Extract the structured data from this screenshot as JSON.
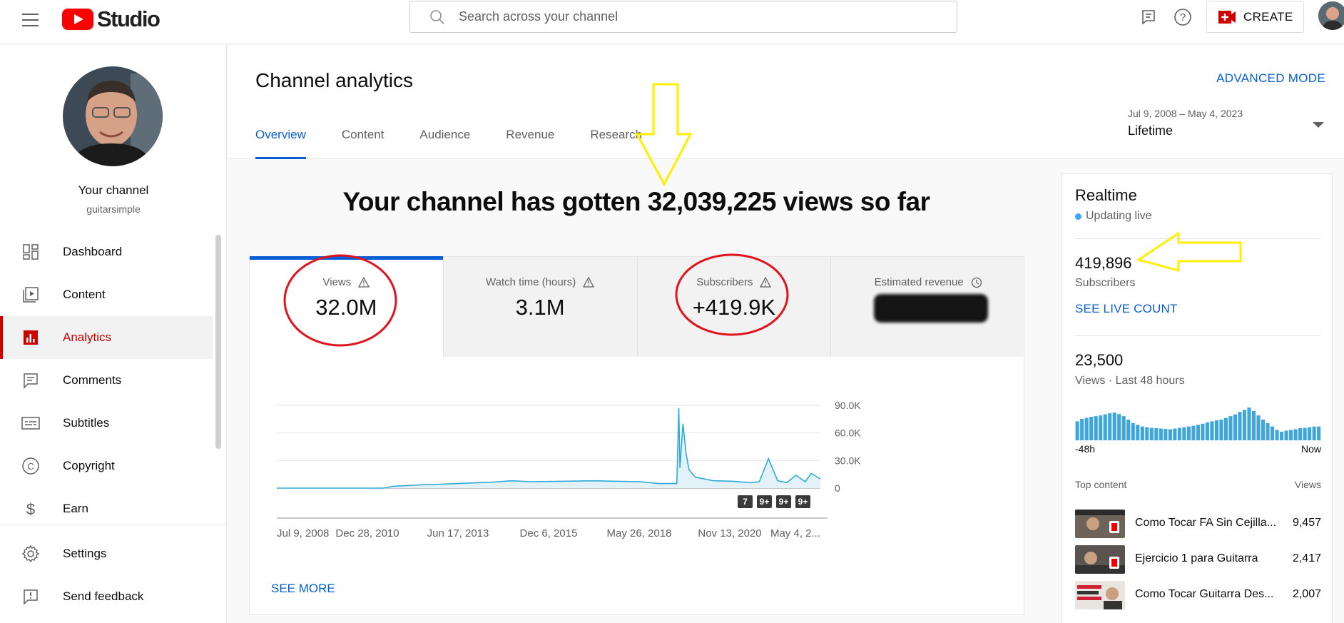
{
  "app": {
    "logo_text": "Studio",
    "search_placeholder": "Search across your channel",
    "create_label": "CREATE"
  },
  "sidebar": {
    "channel_name": "Your channel",
    "channel_handle": "guitarsimple",
    "items": [
      {
        "label": "Dashboard",
        "icon": "dashboard-icon"
      },
      {
        "label": "Content",
        "icon": "content-icon"
      },
      {
        "label": "Analytics",
        "icon": "analytics-icon",
        "active": true
      },
      {
        "label": "Comments",
        "icon": "comments-icon"
      },
      {
        "label": "Subtitles",
        "icon": "subtitles-icon"
      },
      {
        "label": "Copyright",
        "icon": "copyright-icon"
      },
      {
        "label": "Earn",
        "icon": "earn-icon"
      }
    ],
    "bottom_items": [
      {
        "label": "Settings",
        "icon": "gear-icon"
      },
      {
        "label": "Send feedback",
        "icon": "feedback-icon"
      }
    ]
  },
  "header": {
    "title": "Channel analytics",
    "advanced_mode": "ADVANCED MODE",
    "tabs": [
      "Overview",
      "Content",
      "Audience",
      "Revenue",
      "Research"
    ],
    "date_sub": "Jul 9, 2008 – May 4, 2023",
    "date_main": "Lifetime"
  },
  "headline": "Your channel has gotten 32,039,225 views so far",
  "metrics": [
    {
      "label": "Views",
      "value": "32.0M",
      "icon": "warning-icon"
    },
    {
      "label": "Watch time (hours)",
      "value": "3.1M",
      "icon": "warning-icon"
    },
    {
      "label": "Subscribers",
      "value": "+419.9K",
      "icon": "warning-icon"
    },
    {
      "label": "Estimated revenue",
      "value": "",
      "icon": "clock-icon"
    }
  ],
  "see_more": "SEE MORE",
  "chart_data": {
    "type": "area",
    "series": [
      {
        "name": "Views",
        "color": "#2eaad9"
      }
    ],
    "x_ticks": [
      "Jul 9, 2008",
      "Dec 28, 2010",
      "Jun 17, 2013",
      "Dec 6, 2015",
      "May 26, 2018",
      "Nov 13, 2020",
      "May 4, 2..."
    ],
    "y_ticks": [
      "90.0K",
      "60.0K",
      "30.0K",
      "0"
    ],
    "ylim": [
      0,
      90000
    ],
    "x": [
      "2008-07",
      "2011-06",
      "2011-09",
      "2012-06",
      "2013-06",
      "2014-06",
      "2014-12",
      "2015-06",
      "2016-06",
      "2017-03",
      "2017-09",
      "2018-06",
      "2018-12",
      "2019-06",
      "2019-06-20",
      "2019-07",
      "2019-08",
      "2019-09",
      "2019-10",
      "2019-12",
      "2020-03",
      "2020-06",
      "2020-12",
      "2021-06",
      "2021-09",
      "2021-12",
      "2022-03",
      "2022-06",
      "2022-09",
      "2022-12",
      "2023-02",
      "2023-05"
    ],
    "values": [
      0,
      0,
      2000,
      3500,
      5000,
      6500,
      8000,
      7000,
      7500,
      8000,
      7500,
      7000,
      5000,
      5000,
      87000,
      22000,
      70000,
      38000,
      20000,
      12000,
      10000,
      8000,
      7500,
      6000,
      7000,
      32000,
      8000,
      6000,
      14000,
      7000,
      16000,
      10000
    ],
    "markers": [
      "7",
      "9+",
      "9+",
      "9+"
    ]
  },
  "realtime": {
    "title": "Realtime",
    "live": "Updating live",
    "subs_value": "419,896",
    "subs_label": "Subscribers",
    "live_link": "SEE LIVE COUNT",
    "views_value": "23,500",
    "views_label": "Views · Last 48 hours",
    "axis_left": "-48h",
    "axis_right": "Now",
    "bars": [
      55,
      62,
      65,
      68,
      70,
      72,
      75,
      78,
      80,
      76,
      70,
      60,
      50,
      45,
      40,
      38,
      36,
      35,
      34,
      33,
      32,
      34,
      36,
      38,
      40,
      42,
      45,
      48,
      52,
      55,
      58,
      60,
      65,
      70,
      75,
      82,
      88,
      95,
      85,
      72,
      60,
      50,
      40,
      30,
      25,
      28,
      30,
      32,
      35,
      36,
      38,
      40,
      40
    ],
    "top_content_label": "Top content",
    "views_col_label": "Views",
    "top_content": [
      {
        "title": "Como Tocar FA Sin Cejilla...",
        "views": "9,457"
      },
      {
        "title": "Ejercicio 1 para Guitarra",
        "views": "2,417"
      },
      {
        "title": "Como Tocar Guitarra Des...",
        "views": "2,007"
      }
    ]
  }
}
